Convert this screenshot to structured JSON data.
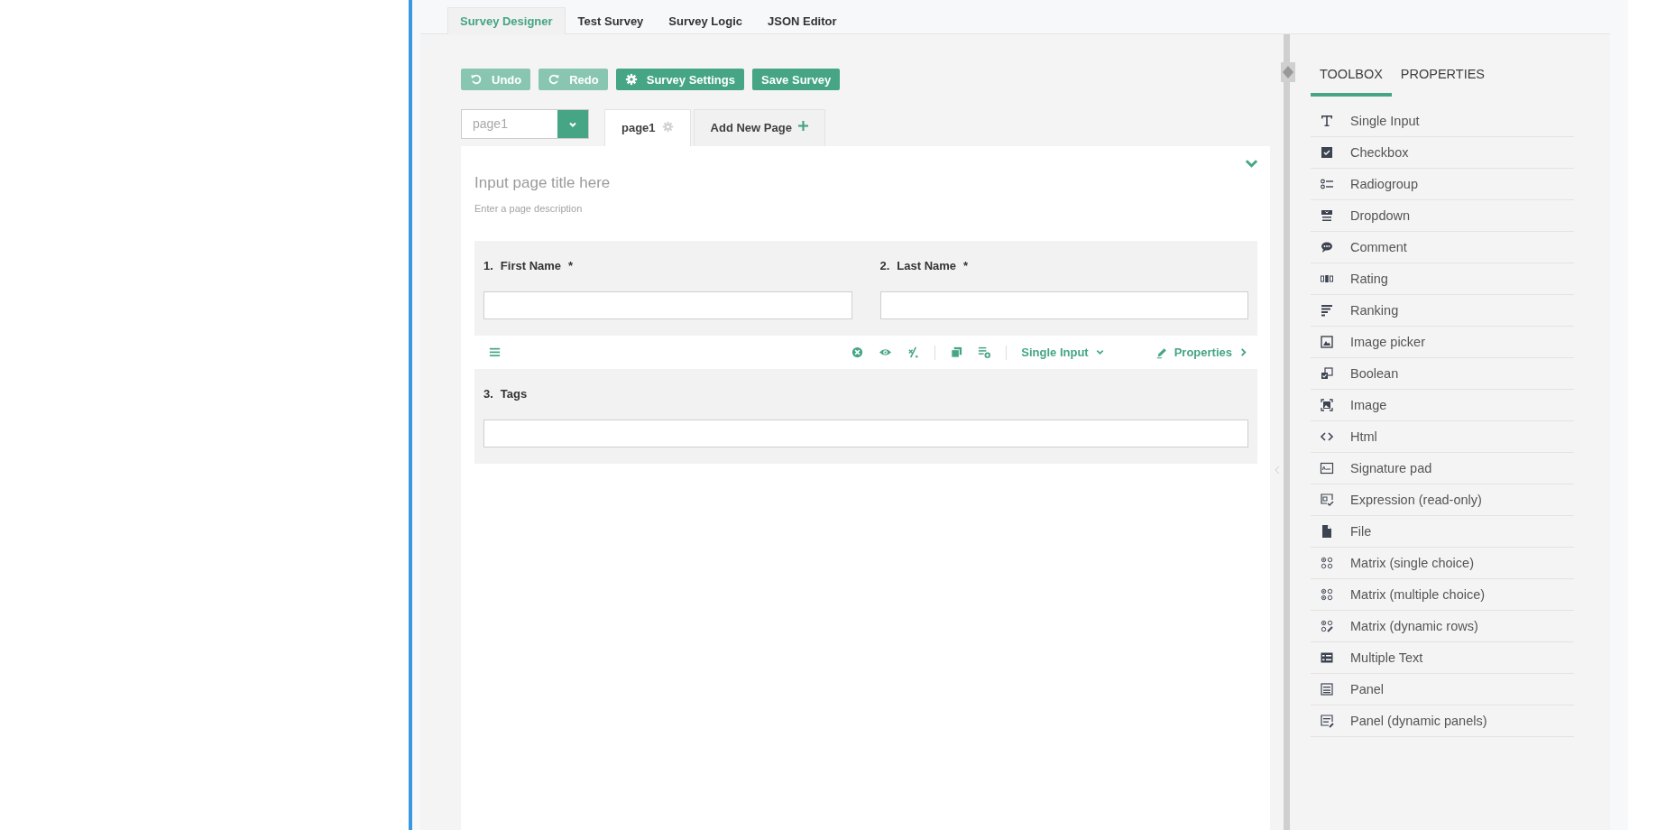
{
  "main_tabs": [
    {
      "label": "Survey Designer",
      "selected": true
    },
    {
      "label": "Test Survey",
      "selected": false
    },
    {
      "label": "Survey Logic",
      "selected": false
    },
    {
      "label": "JSON Editor",
      "selected": false
    }
  ],
  "toolbar": [
    {
      "label": "Undo",
      "kind": "undo",
      "disabled": true
    },
    {
      "label": "Redo",
      "kind": "redo",
      "disabled": true
    },
    {
      "label": "Survey Settings",
      "kind": "settings",
      "disabled": false
    },
    {
      "label": "Save Survey",
      "kind": "save",
      "disabled": false
    }
  ],
  "page_selector": {
    "value": "page1"
  },
  "page_tabs": [
    {
      "label": "page1",
      "kind": "page",
      "selected": true
    },
    {
      "label": "Add New Page",
      "kind": "add",
      "selected": false
    }
  ],
  "page": {
    "title_placeholder": "Input page title here",
    "description_placeholder": "Enter a page description"
  },
  "rows": [
    {
      "selected": false,
      "questions": [
        {
          "number": "1.",
          "title": "First Name",
          "required_mark": "*"
        },
        {
          "number": "2.",
          "title": "Last Name",
          "required_mark": "*"
        }
      ]
    },
    {
      "selected": true,
      "questions": [
        {
          "number": "3.",
          "title": "Tags"
        }
      ]
    }
  ],
  "question_toolbar": {
    "type_label": "Single Input",
    "properties_label": "Properties"
  },
  "side_tabs": [
    {
      "label": "TOOLBOX",
      "selected": true
    },
    {
      "label": "PROPERTIES",
      "selected": false
    }
  ],
  "toolbox": [
    "Single Input",
    "Checkbox",
    "Radiogroup",
    "Dropdown",
    "Comment",
    "Rating",
    "Ranking",
    "Image picker",
    "Boolean",
    "Image",
    "Html",
    "Signature pad",
    "Expression (read-only)",
    "File",
    "Matrix (single choice)",
    "Matrix (multiple choice)",
    "Matrix (dynamic rows)",
    "Multiple Text",
    "Panel",
    "Panel (dynamic panels)"
  ]
}
